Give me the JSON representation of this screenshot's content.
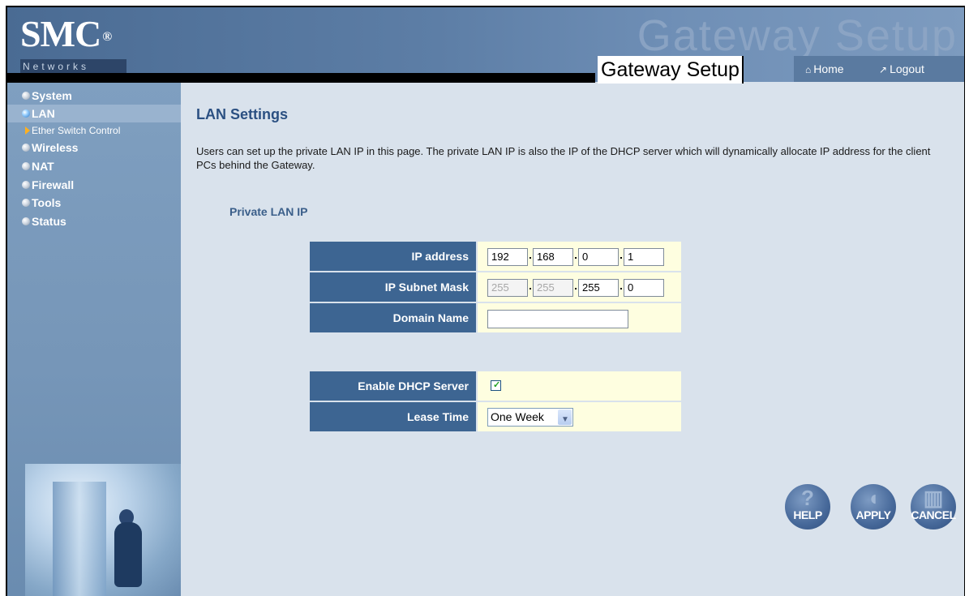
{
  "header": {
    "logo_main": "SMC",
    "logo_reg": "®",
    "logo_sub": "Networks",
    "watermark": "Gateway Setup",
    "title": "Gateway Setup",
    "home_label": "Home",
    "logout_label": "Logout"
  },
  "sidebar": {
    "items": [
      {
        "label": "System"
      },
      {
        "label": "LAN"
      },
      {
        "label": "Ether Switch Control"
      },
      {
        "label": "Wireless"
      },
      {
        "label": "NAT"
      },
      {
        "label": "Firewall"
      },
      {
        "label": "Tools"
      },
      {
        "label": "Status"
      }
    ]
  },
  "main": {
    "title": "LAN Settings",
    "description": "Users can set up the private LAN IP in this page. The private LAN IP is also the IP of the DHCP server which will dynamically allocate IP address for the client PCs behind the Gateway.",
    "section_title": "Private LAN IP",
    "ip_address": {
      "label": "IP address",
      "octets": [
        "192",
        "168",
        "0",
        "1"
      ]
    },
    "subnet_mask": {
      "label": "IP Subnet Mask",
      "octets": [
        "255",
        "255",
        "255",
        "0"
      ]
    },
    "domain_name": {
      "label": "Domain Name",
      "value": ""
    },
    "dhcp": {
      "label": "Enable DHCP Server",
      "checked": true,
      "check_glyph": "✓"
    },
    "lease_time": {
      "label": "Lease Time",
      "selected": "One Week"
    }
  },
  "buttons": {
    "help": "HELP",
    "apply": "APPLY",
    "cancel": "CANCEL"
  }
}
